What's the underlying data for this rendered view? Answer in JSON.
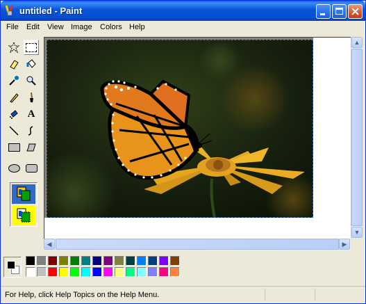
{
  "window": {
    "title": "untitled - Paint"
  },
  "menu": [
    "File",
    "Edit",
    "View",
    "Image",
    "Colors",
    "Help"
  ],
  "status": {
    "text": "For Help, click Help Topics on the Help Menu."
  },
  "colors": {
    "foreground": "#000000",
    "background": "#ffffff",
    "palette_top": [
      "#000000",
      "#808080",
      "#800000",
      "#808000",
      "#008000",
      "#008080",
      "#000080",
      "#800080",
      "#808040",
      "#004040",
      "#0080ff",
      "#004080",
      "#8000ff",
      "#804000"
    ],
    "palette_bottom": [
      "#ffffff",
      "#c0c0c0",
      "#ff0000",
      "#ffff00",
      "#00ff00",
      "#00ffff",
      "#0000ff",
      "#ff00ff",
      "#ffff80",
      "#00ff80",
      "#80ffff",
      "#8080ff",
      "#ff0080",
      "#ff8040"
    ]
  },
  "tools": [
    "free-form-select-icon",
    "select-icon",
    "eraser-icon",
    "fill-icon",
    "color-picker-icon",
    "magnifier-icon",
    "pencil-icon",
    "brush-icon",
    "airbrush-icon",
    "text-icon",
    "line-icon",
    "curve-icon",
    "rectangle-icon",
    "polygon-icon",
    "ellipse-icon",
    "rounded-rectangle-icon"
  ]
}
